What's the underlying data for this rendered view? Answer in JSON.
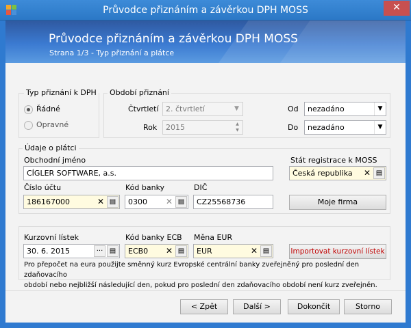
{
  "window": {
    "title": "Průvodce přiznáním a závěrkou DPH MOSS",
    "close_glyph": "✕"
  },
  "header": {
    "title": "Průvodce přiznáním a závěrkou DPH MOSS",
    "subtitle": "Strana 1/3 - Typ přiznání a plátce"
  },
  "typ_priznani": {
    "legend": "Typ přiznání k DPH",
    "options": [
      "Řádné",
      "Opravné"
    ],
    "selected": "Řádné"
  },
  "obdobi": {
    "legend": "Období přiznání",
    "ctvrtleti_label": "Čtvrtletí",
    "ctvrtleti_value": "2. čtvrtletí",
    "rok_label": "Rok",
    "rok_value": "2015",
    "od_label": "Od",
    "od_value": "nezadáno",
    "do_label": "Do",
    "do_value": "nezadáno"
  },
  "platce": {
    "legend": "Údaje o plátci",
    "obchodni_jmeno_label": "Obchodní jméno",
    "obchodni_jmeno_value": "CÍGLER SOFTWARE, a.s.",
    "stat_label": "Stát registrace k MOSS",
    "stat_value": "Česká republika",
    "cislo_uctu_label": "Číslo účtu",
    "cislo_uctu_value": "186167000",
    "kod_banky_label": "Kód banky",
    "kod_banky_value": "0300",
    "dic_label": "DIČ",
    "dic_value": "CZ25568736",
    "moje_firma_label": "Moje firma"
  },
  "kurz": {
    "kurzovni_listek_label": "Kurzovní lístek",
    "kurzovni_listek_value": "30. 6. 2015",
    "kod_banky_ecb_label": "Kód banky ECB",
    "kod_banky_ecb_value": "ECB0",
    "mena_eur_label": "Měna EUR",
    "mena_eur_value": "EUR",
    "import_label": "Importovat kurzovní lístek",
    "note_line1": "Pro přepočet na eura použijte směnný kurz Evropské centrální banky zveřejněný pro poslední den zdaňovacího",
    "note_line2": "období nebo nejbližší následující den, pokud pro poslední den zdaňovacího období není kurz zveřejněn."
  },
  "buttons": {
    "back": "< Zpět",
    "next": "Další >",
    "finish": "Dokončit",
    "cancel": "Storno"
  },
  "icons": {
    "clear": "✕",
    "list": "▤",
    "ellipsis": "···",
    "dropdown": "▼",
    "spin_up": "▲",
    "spin_down": "▼"
  },
  "colors": {
    "titlebar": "#2f7ad0",
    "close_button": "#c75050",
    "required_field": "#fffbe0",
    "import_text": "#c00000"
  }
}
